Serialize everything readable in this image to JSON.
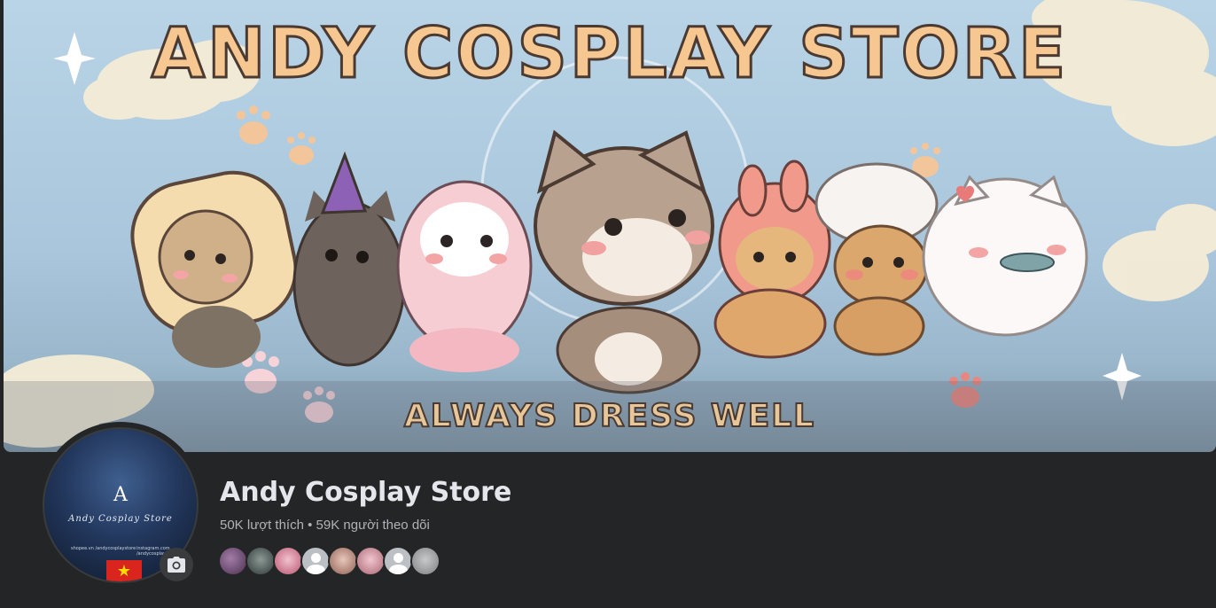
{
  "cover": {
    "title": "ANDY COSPLAY STORE",
    "subtitle": "ALWAYS DRESS WELL"
  },
  "avatar": {
    "brand": "Andy Cosplay Store",
    "logo_glyph": "A",
    "left_small": "shopee.vn /andycosplaystore",
    "right_small": "instagram.com /andycosplaystore"
  },
  "page": {
    "name": "Andy Cosplay Store",
    "likes": "50K lượt thích",
    "separator": "•",
    "followers": "59K người theo dõi"
  },
  "follower_faces": [
    {
      "icon": "friend-avatar-1",
      "color": "#6b4b6e"
    },
    {
      "icon": "friend-avatar-2",
      "color": "#4f5b5a"
    },
    {
      "icon": "friend-avatar-3",
      "color": "#d78aa0"
    },
    {
      "icon": "default-avatar-icon",
      "color": "#bcc0c4"
    },
    {
      "icon": "friend-avatar-5",
      "color": "#b88f86"
    },
    {
      "icon": "friend-avatar-6",
      "color": "#c98f9b"
    },
    {
      "icon": "default-avatar-icon",
      "color": "#bcc0c4"
    },
    {
      "icon": "friend-avatar-8",
      "color": "#9a9c9e"
    }
  ],
  "icons": {
    "camera": "camera-icon",
    "flag": "vietnam-flag-icon"
  },
  "colors": {
    "background": "#242526",
    "name": "#e4e6eb",
    "secondary_text": "#b0b3b8"
  }
}
